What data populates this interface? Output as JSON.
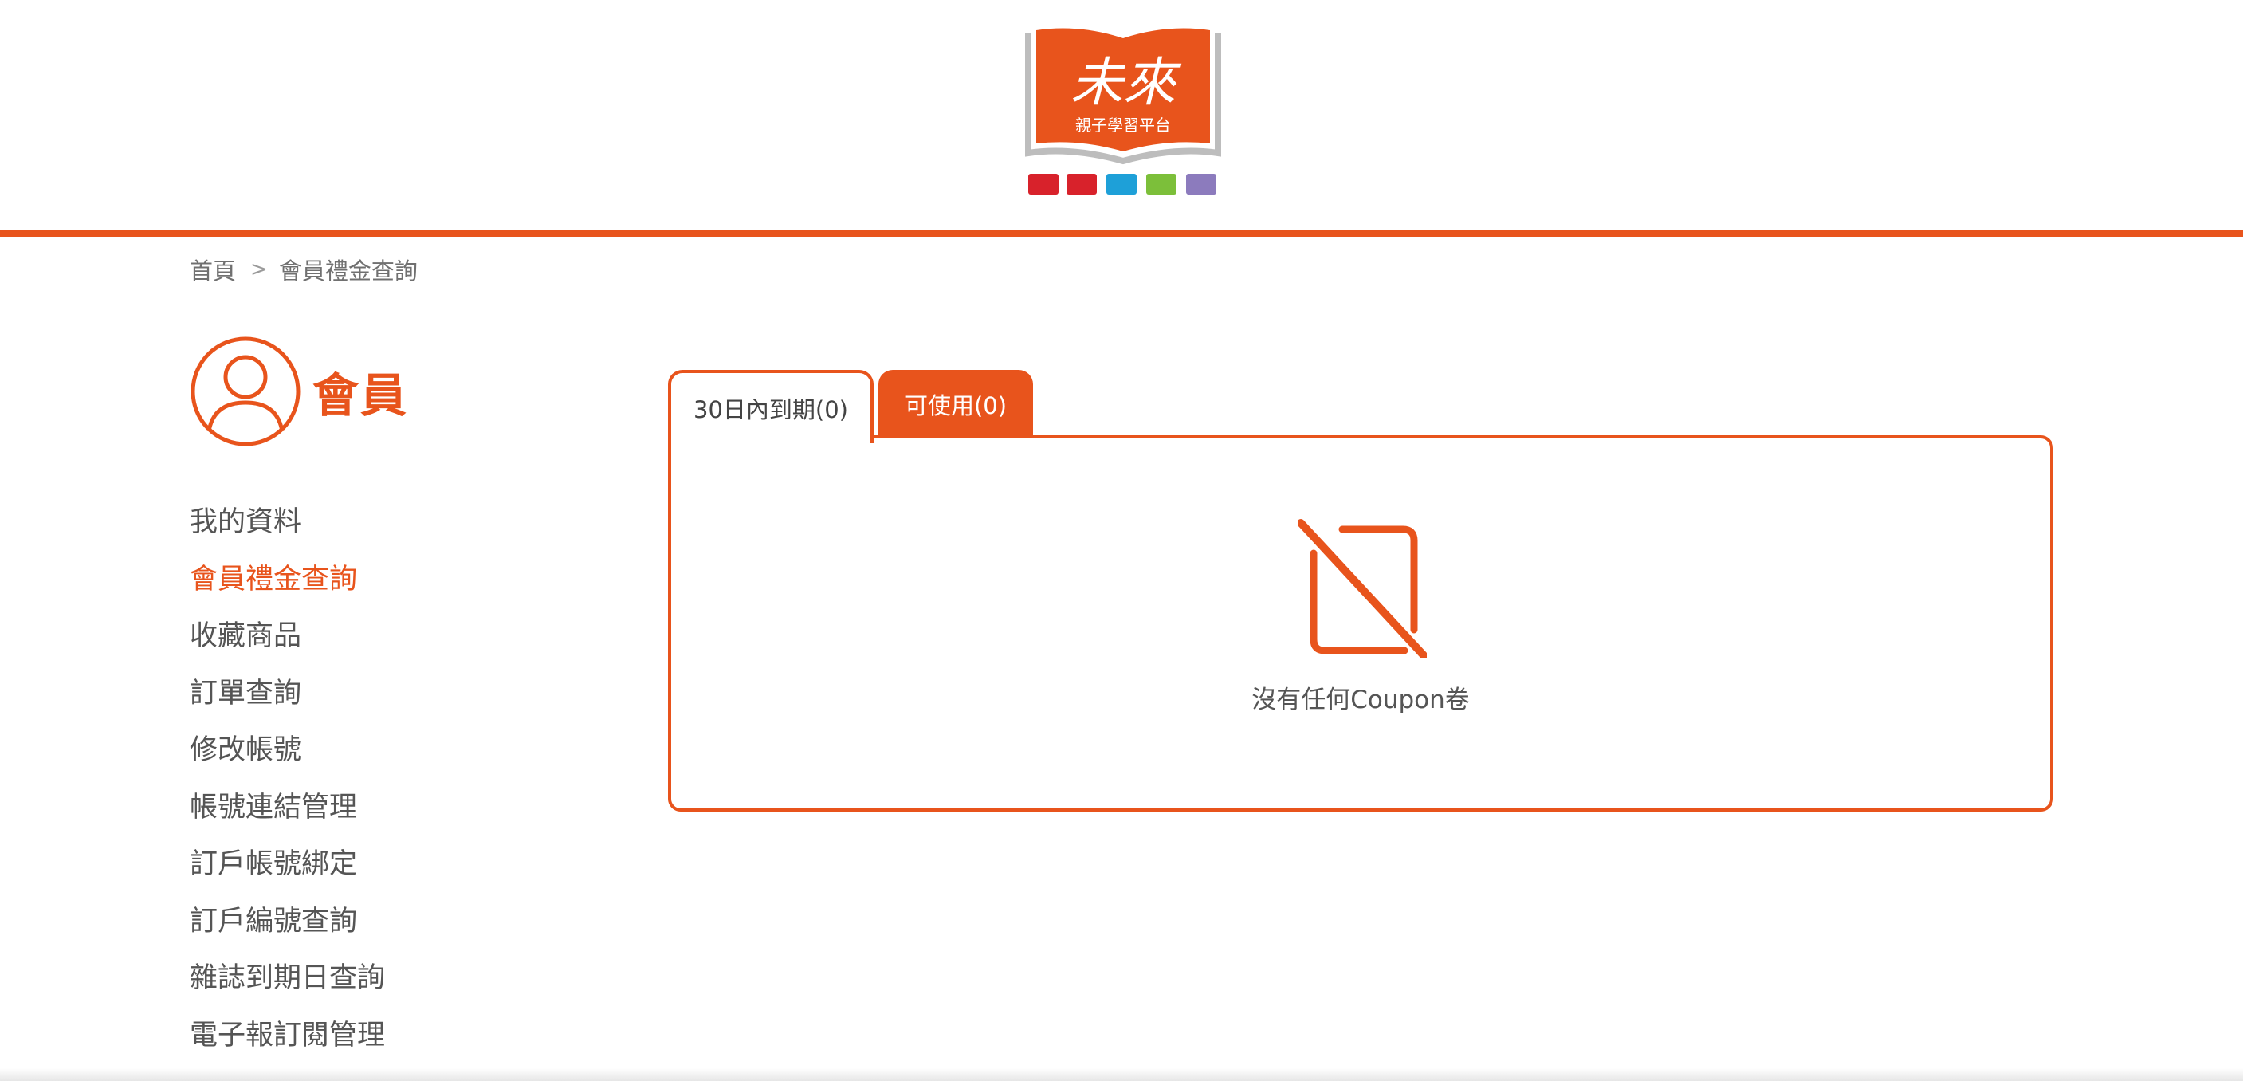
{
  "logo": {
    "brand_text": "未來",
    "subtitle": "親子學習平台",
    "icon": "open-book-logo",
    "colors": {
      "primary": "#e8541c",
      "frame": "#b8b8b8",
      "chips": [
        "#d8222b",
        "#d8222b",
        "#1ea0d8",
        "#7cbf3a",
        "#8c7bbd"
      ]
    }
  },
  "breadcrumb": {
    "home": "首頁",
    "separator": ">",
    "current": "會員禮金查詢"
  },
  "member": {
    "title": "會員",
    "icon": "user-circle-icon"
  },
  "menu": {
    "items": [
      {
        "label": "我的資料"
      },
      {
        "label": "會員禮金查詢",
        "active": true
      },
      {
        "label": "收藏商品"
      },
      {
        "label": "訂單查詢"
      },
      {
        "label": "修改帳號"
      },
      {
        "label": "帳號連結管理"
      },
      {
        "label": "訂戶帳號綁定"
      },
      {
        "label": "訂戶編號查詢"
      },
      {
        "label": "雜誌到期日查詢"
      },
      {
        "label": "電子報訂閱管理"
      }
    ]
  },
  "tabs": {
    "expiring": "30日內到期(0)",
    "available": "可使用(0)"
  },
  "empty_state": {
    "icon": "no-coupon-icon",
    "message": "沒有任何Coupon卷"
  },
  "theme": {
    "accent": "#e8541c",
    "text": "#555555"
  }
}
